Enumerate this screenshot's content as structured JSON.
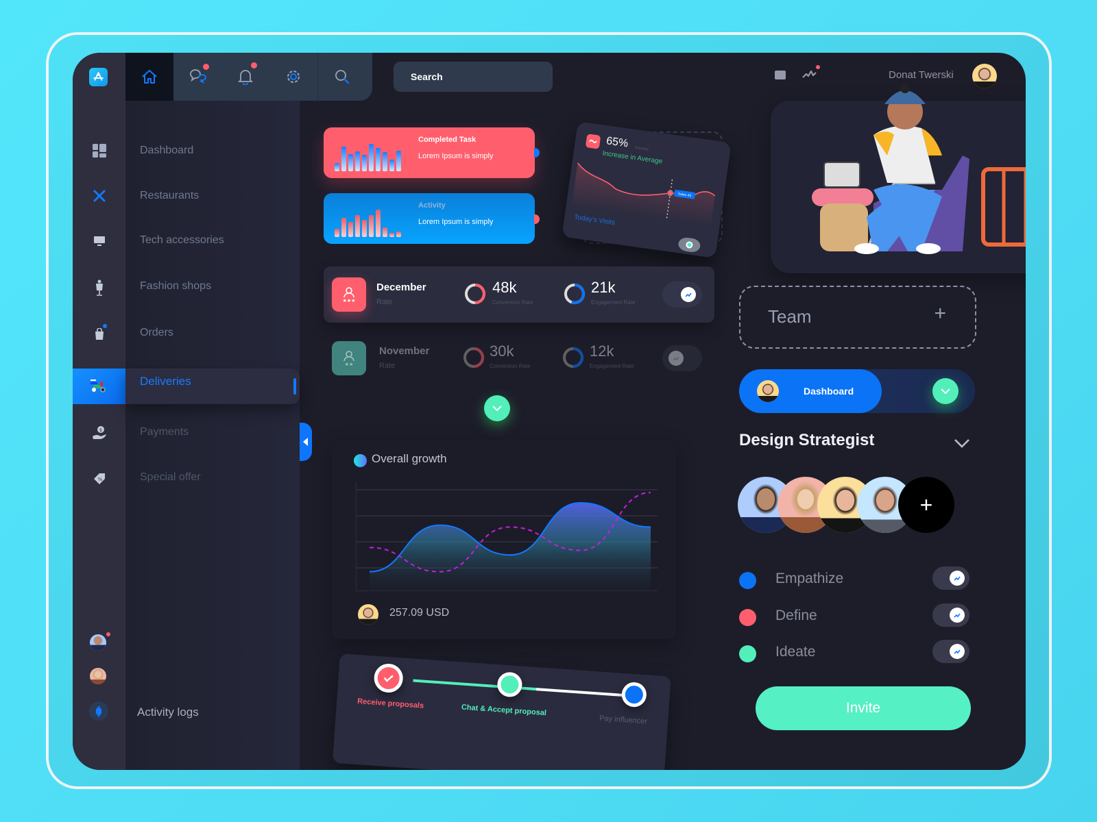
{
  "header": {
    "search_label": "Search",
    "user_name": "Donat Twerski",
    "tabs": [
      {
        "name": "home",
        "icon": "home-icon",
        "active": true
      },
      {
        "name": "messages",
        "icon": "chat-icon",
        "badge": true
      },
      {
        "name": "notifications",
        "icon": "bell-icon",
        "badge": true
      },
      {
        "name": "settings",
        "icon": "gear-icon"
      },
      {
        "name": "search",
        "icon": "search-icon"
      }
    ],
    "right_icons": [
      "window-icon",
      "activity-icon"
    ]
  },
  "sidebar": {
    "items": [
      {
        "label": "Dashboard",
        "icon": "grid-icon"
      },
      {
        "label": "Restaurants",
        "icon": "utensils-icon"
      },
      {
        "label": "Tech accessories",
        "icon": "monitor-icon"
      },
      {
        "label": "Fashion shops",
        "icon": "mannequin-icon"
      },
      {
        "label": "Orders",
        "icon": "bag-icon",
        "badge": true
      },
      {
        "label": "Deliveries",
        "icon": "scooter-icon",
        "active": true
      },
      {
        "label": "Payments",
        "icon": "hand-coin-icon"
      },
      {
        "label": "Special offer",
        "icon": "tag-icon"
      }
    ],
    "footer_label": "Activity logs"
  },
  "kpi_cards": [
    {
      "title": "Completed Task",
      "subtitle": "Lorem Ipsum is simply",
      "color": "#ff5f6d",
      "bars": [
        0.3,
        0.9,
        0.62,
        0.72,
        0.6,
        1.0,
        0.86,
        0.7,
        0.42,
        0.76
      ]
    },
    {
      "title": "Activity",
      "subtitle": "Lorem Ipsum is simply",
      "color": "#0ea4f6",
      "bars": [
        0.3,
        0.7,
        0.55,
        0.8,
        0.62,
        0.8,
        1.0,
        0.34,
        0.14,
        0.2
      ]
    }
  ],
  "visits_card": {
    "percent": "65%",
    "percent_label": "Income",
    "trend_label": "Increase in Average",
    "footer_label": "Today's Visits",
    "tooltip": "Sales 45"
  },
  "stats": [
    {
      "month": "December",
      "rate_label": "Rate",
      "conversion": "48k",
      "conversion_label": "Conversion Rate",
      "conversion_pct": 0.5,
      "engagement": "21k",
      "engagement_label": "Engagement Rate",
      "engagement_pct": 0.55,
      "icon_color": "#ff5f6d",
      "stars": "★★★"
    },
    {
      "month": "November",
      "rate_label": "Rate",
      "conversion": "30k",
      "conversion_label": "Conversion Rate",
      "conversion_pct": 0.5,
      "engagement": "12k",
      "engagement_label": "Engagement Rate",
      "engagement_pct": 0.5,
      "icon_color": "#4ea59a",
      "stars": "★★"
    }
  ],
  "growth": {
    "title": "Overall growth",
    "amount": "257.09 USD",
    "series_solid": [
      0.12,
      0.62,
      0.3,
      0.86,
      0.6
    ],
    "series_dashed": [
      0.38,
      0.12,
      0.6,
      0.35,
      0.97
    ]
  },
  "stepper": {
    "steps": [
      {
        "label": "Receive proposals",
        "state": "done",
        "color": "#ff5f6d"
      },
      {
        "label": "Chat & Accept proposal",
        "state": "current",
        "color": "#52efbb"
      },
      {
        "label": "Pay influencer",
        "state": "pending",
        "color": "#0b73f5"
      }
    ]
  },
  "right_panel": {
    "team_label": "Team",
    "team_add": "+",
    "dashboard_pill": "Dashboard",
    "section_title": "Design Strategist",
    "add_member": "+",
    "phases": [
      {
        "label": "Empathize",
        "color": "#0b73f5"
      },
      {
        "label": "Define",
        "color": "#ff5f6d"
      },
      {
        "label": "Ideate",
        "color": "#52efbb"
      }
    ],
    "invite_label": "Invite"
  }
}
